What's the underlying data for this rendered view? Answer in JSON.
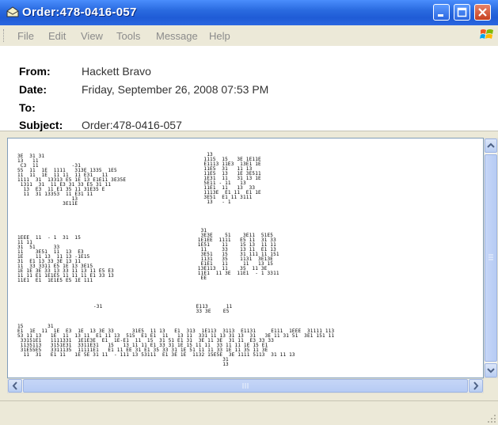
{
  "window": {
    "title": "Order:478-0416-057",
    "title_icon": "envelope-icon",
    "controls": [
      "minimize-icon",
      "maximize-icon",
      "close-icon"
    ]
  },
  "menu": {
    "items": [
      "File",
      "Edit",
      "View",
      "Tools",
      "Message",
      "Help"
    ],
    "logo_icon": "windows-logo-icon"
  },
  "header": {
    "from_label": "From:",
    "from_value": "Hackett Bravo",
    "date_label": "Date:",
    "date_value": "Friday, September 26, 2008 07:53 PM",
    "to_label": "To:",
    "to_value": "",
    "subject_label": "Subject:",
    "subject_value": "Order:478-0416-057"
  },
  "body": {
    "art_blocks": [
      "3E  31 31\n13   11\n C3  11           -31\n55  11  1E  1111   313E 1335  1E5\n11  11  1E  11 11  11 E31   11\n1111  31  13313 E5 1E 13 E1E11 3E35E\n 1311  31  11 E3 31 33 E5 31 11\n  13  E3  11 E1 35 11 31E35 E\n  11  31 13353  11 E31 11\n                  13\n               3E11E",
      "    13\n   1115  15   3E 1E11E\n   E1113 11E3  13E1 1E\n   11E5  31   11 13\n   11E5  13   1E 3E511\n   1E31  11   31 13 1E\n   5E11 - 11   13\n   11E1  11   13  33\n   1113E  E1 11  E1 1E\n   3E51  E1 11 3111\n    13   - 1",
      "1EEE  11  - 1  31  15\n11 11\n31  51      33\n11    3E51  11  13  E3\n1E    11 13  11 13 -1E15\n31  E1 13 33 3E 13 11\n11  33 3311 E5 1E 13 3E15\n1E 1E 3E 33 13 33 11 13 11 E5 E3\n11 11 E1 1E1E5 11 11 11 E1 33 13\n11E1  E1  1E1E5 E5 1E 111",
      "  31\n  3E3E    51    3E11  51E5\n 1E1EE  1111   E5 11  31 33\n 1E51    11    15 13  11 11\n  11     33    13 11  E1 13\n  3E51   15    31 111 11 151\n  1131   35    1131  3E13E\n  E1E1   11     11   13 15\n 13E113  11    35  11 3E\n 11E1  11 3E  11E1  - 1 3311\n  EE",
      "-31                               E113      11\n                                  33 3E    E5",
      "15        31\nE1  1E  11  1E  E3  1E  13 3E 33      31E5  11 13   E1  313  1E113  3113  E1131     E111  1EEE  31111 113\n53 11 13   1E  11  13 11  E1 11 13  515  E1 E1  11   13 11  331 11 13 31 13  31   3E 11 31 51  3E1 151 11\n 33151E1   1111331  1E1E3E  E1  1E-E1  11  15  31 51 E1 31  3E 11 3E  31 11  E3 33 33\n 1135113   3151E31  3311E31   15   13 11 11 E1 33 31 1E 15 11 11  33 11 11 1E 15 E1\n 31E55E5   3311135  11111E1   E1 11 EE 31 E1 35 33 31 1E 51 11 11 33 1E 11 35 11 3E\n  11  31   E1 11   1E 5E 31 11  - 111 13 53111  E1 3E 1E  1132 15E5E  3E 1111 5113  31 11 13\n                                                                    31\n                                                                    13"
    ]
  },
  "scrollbars": {
    "vertical_icons": [
      "scroll-up-arrow-icon",
      "scroll-down-arrow-icon"
    ],
    "horizontal_icons": [
      "scroll-left-arrow-icon",
      "scroll-right-arrow-icon"
    ]
  }
}
